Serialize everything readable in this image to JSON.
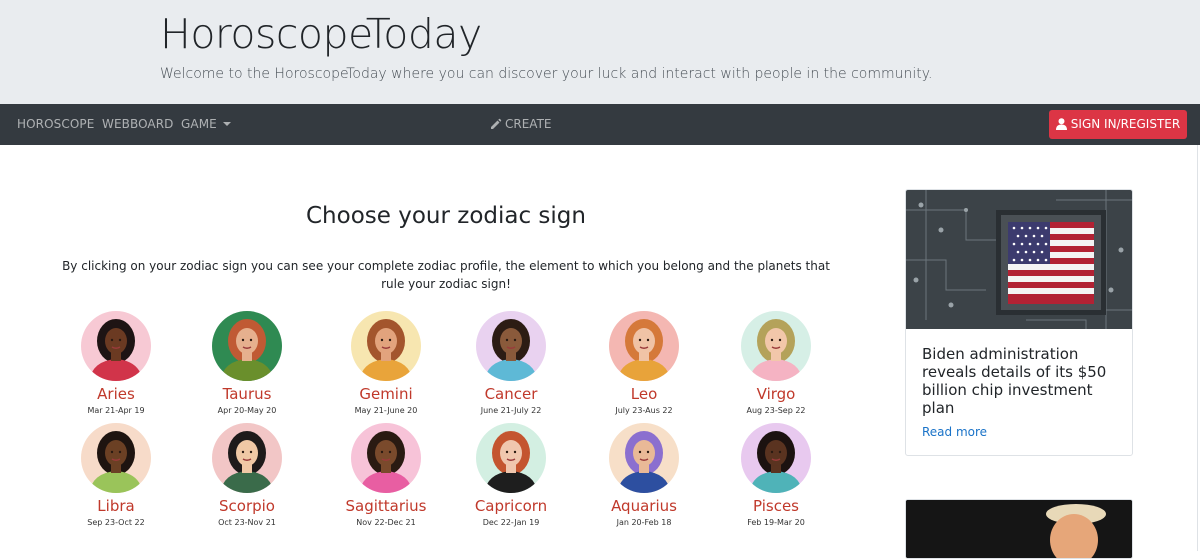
{
  "header": {
    "title": "HoroscopeToday",
    "subtitle": "Welcome to the HoroscopeToday where you can discover your luck and interact with people in the community."
  },
  "nav": {
    "horoscope": "HOROSCOPE",
    "webboard": "WEBBOARD",
    "game": "GAME",
    "create": "CREATE",
    "signin": "SIGN IN/REGISTER"
  },
  "main": {
    "title": "Choose your zodiac sign",
    "intro": "By clicking on your zodiac sign you can see your complete zodiac profile, the element to which you belong and the planets that rule your zodiac sign!",
    "signs": [
      {
        "name": "Aries",
        "dates": "Mar 21-Apr 19",
        "bg": "#f7c9d4",
        "skin": "#6b3a22",
        "hair": "#1e1414",
        "cloth": "#d1344a"
      },
      {
        "name": "Taurus",
        "dates": "Apr 20-May 20",
        "bg": "#2f8a52",
        "skin": "#e6b08e",
        "hair": "#c05a34",
        "cloth": "#6a8f2c"
      },
      {
        "name": "Gemini",
        "dates": "May 21-June 20",
        "bg": "#f7e6b0",
        "skin": "#e2a37d",
        "hair": "#a3552d",
        "cloth": "#e9a43a"
      },
      {
        "name": "Cancer",
        "dates": "June 21-July 22",
        "bg": "#e9d2f0",
        "skin": "#8a5a3b",
        "hair": "#2c1c14",
        "cloth": "#5eb9d6"
      },
      {
        "name": "Leo",
        "dates": "July 23-Aus 22",
        "bg": "#f4b7b2",
        "skin": "#f0c3a6",
        "hair": "#d5793a",
        "cloth": "#e8a33a"
      },
      {
        "name": "Virgo",
        "dates": "Aug 23-Sep 22",
        "bg": "#d6efe6",
        "skin": "#f2c7aa",
        "hair": "#b4a25a",
        "cloth": "#f5b3c3"
      },
      {
        "name": "Libra",
        "dates": "Sep 23-Oct 22",
        "bg": "#f7dbc9",
        "skin": "#6b4024",
        "hair": "#1e1410",
        "cloth": "#9ac45a"
      },
      {
        "name": "Scorpio",
        "dates": "Oct 23-Nov 21",
        "bg": "#f2c6c6",
        "skin": "#f0c8a5",
        "hair": "#1e1a1a",
        "cloth": "#3a6b4a"
      },
      {
        "name": "Sagittarius",
        "dates": "Nov 22-Dec 21",
        "bg": "#f7c3d8",
        "skin": "#7a4a2c",
        "hair": "#2a1a12",
        "cloth": "#e85ea2"
      },
      {
        "name": "Capricorn",
        "dates": "Dec 22-Jan 19",
        "bg": "#d3efe2",
        "skin": "#f0c7ae",
        "hair": "#c4552f",
        "cloth": "#1e1e1e"
      },
      {
        "name": "Aquarius",
        "dates": "Jan 20-Feb 18",
        "bg": "#f7dfc8",
        "skin": "#e9b997",
        "hair": "#8b6fcf",
        "cloth": "#2d4fa0"
      },
      {
        "name": "Pisces",
        "dates": "Feb 19-Mar 20",
        "bg": "#e8c9ef",
        "skin": "#5a3320",
        "hair": "#1c1210",
        "cloth": "#4fb3b8"
      }
    ]
  },
  "sidebar": {
    "card_title": "Biden administration reveals details of its $50 billion chip investment plan",
    "card_link": "Read more"
  }
}
